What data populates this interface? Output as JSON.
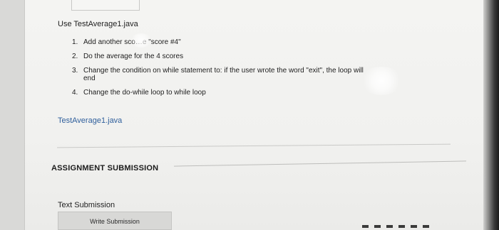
{
  "assignment": {
    "instructions_title": "Use TestAverage1.java",
    "steps": [
      {
        "number": "1.",
        "text": "Add another sco…e \"score #4\""
      },
      {
        "number": "2.",
        "text": "Do the average for the 4 scores"
      },
      {
        "number": "3.",
        "text": "Change the condition on while statement to: if the user wrote the word \"exit\", the loop will end"
      },
      {
        "number": "4.",
        "text": "Change the do-while loop to while loop"
      }
    ],
    "attachment_link": "TestAverage1.java"
  },
  "submission": {
    "section_title": "ASSIGNMENT SUBMISSION",
    "text_submission_label": "Text Submission",
    "write_button_label": "Write Submission"
  },
  "colors": {
    "link": "#2f5f9c",
    "background": "#f2f2f0",
    "button": "#d8d8d6"
  }
}
